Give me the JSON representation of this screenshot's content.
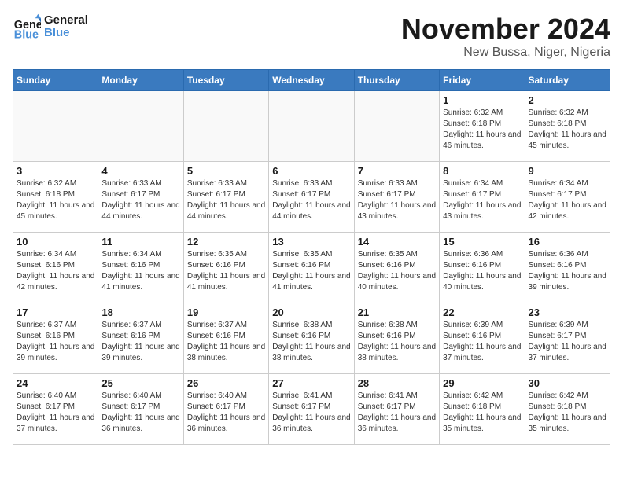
{
  "logo": {
    "general": "General",
    "blue": "Blue"
  },
  "title": "November 2024",
  "subtitle": "New Bussa, Niger, Nigeria",
  "header_days": [
    "Sunday",
    "Monday",
    "Tuesday",
    "Wednesday",
    "Thursday",
    "Friday",
    "Saturday"
  ],
  "weeks": [
    [
      {
        "day": "",
        "info": ""
      },
      {
        "day": "",
        "info": ""
      },
      {
        "day": "",
        "info": ""
      },
      {
        "day": "",
        "info": ""
      },
      {
        "day": "",
        "info": ""
      },
      {
        "day": "1",
        "info": "Sunrise: 6:32 AM\nSunset: 6:18 PM\nDaylight: 11 hours and 46 minutes."
      },
      {
        "day": "2",
        "info": "Sunrise: 6:32 AM\nSunset: 6:18 PM\nDaylight: 11 hours and 45 minutes."
      }
    ],
    [
      {
        "day": "3",
        "info": "Sunrise: 6:32 AM\nSunset: 6:18 PM\nDaylight: 11 hours and 45 minutes."
      },
      {
        "day": "4",
        "info": "Sunrise: 6:33 AM\nSunset: 6:17 PM\nDaylight: 11 hours and 44 minutes."
      },
      {
        "day": "5",
        "info": "Sunrise: 6:33 AM\nSunset: 6:17 PM\nDaylight: 11 hours and 44 minutes."
      },
      {
        "day": "6",
        "info": "Sunrise: 6:33 AM\nSunset: 6:17 PM\nDaylight: 11 hours and 44 minutes."
      },
      {
        "day": "7",
        "info": "Sunrise: 6:33 AM\nSunset: 6:17 PM\nDaylight: 11 hours and 43 minutes."
      },
      {
        "day": "8",
        "info": "Sunrise: 6:34 AM\nSunset: 6:17 PM\nDaylight: 11 hours and 43 minutes."
      },
      {
        "day": "9",
        "info": "Sunrise: 6:34 AM\nSunset: 6:17 PM\nDaylight: 11 hours and 42 minutes."
      }
    ],
    [
      {
        "day": "10",
        "info": "Sunrise: 6:34 AM\nSunset: 6:16 PM\nDaylight: 11 hours and 42 minutes."
      },
      {
        "day": "11",
        "info": "Sunrise: 6:34 AM\nSunset: 6:16 PM\nDaylight: 11 hours and 41 minutes."
      },
      {
        "day": "12",
        "info": "Sunrise: 6:35 AM\nSunset: 6:16 PM\nDaylight: 11 hours and 41 minutes."
      },
      {
        "day": "13",
        "info": "Sunrise: 6:35 AM\nSunset: 6:16 PM\nDaylight: 11 hours and 41 minutes."
      },
      {
        "day": "14",
        "info": "Sunrise: 6:35 AM\nSunset: 6:16 PM\nDaylight: 11 hours and 40 minutes."
      },
      {
        "day": "15",
        "info": "Sunrise: 6:36 AM\nSunset: 6:16 PM\nDaylight: 11 hours and 40 minutes."
      },
      {
        "day": "16",
        "info": "Sunrise: 6:36 AM\nSunset: 6:16 PM\nDaylight: 11 hours and 39 minutes."
      }
    ],
    [
      {
        "day": "17",
        "info": "Sunrise: 6:37 AM\nSunset: 6:16 PM\nDaylight: 11 hours and 39 minutes."
      },
      {
        "day": "18",
        "info": "Sunrise: 6:37 AM\nSunset: 6:16 PM\nDaylight: 11 hours and 39 minutes."
      },
      {
        "day": "19",
        "info": "Sunrise: 6:37 AM\nSunset: 6:16 PM\nDaylight: 11 hours and 38 minutes."
      },
      {
        "day": "20",
        "info": "Sunrise: 6:38 AM\nSunset: 6:16 PM\nDaylight: 11 hours and 38 minutes."
      },
      {
        "day": "21",
        "info": "Sunrise: 6:38 AM\nSunset: 6:16 PM\nDaylight: 11 hours and 38 minutes."
      },
      {
        "day": "22",
        "info": "Sunrise: 6:39 AM\nSunset: 6:16 PM\nDaylight: 11 hours and 37 minutes."
      },
      {
        "day": "23",
        "info": "Sunrise: 6:39 AM\nSunset: 6:17 PM\nDaylight: 11 hours and 37 minutes."
      }
    ],
    [
      {
        "day": "24",
        "info": "Sunrise: 6:40 AM\nSunset: 6:17 PM\nDaylight: 11 hours and 37 minutes."
      },
      {
        "day": "25",
        "info": "Sunrise: 6:40 AM\nSunset: 6:17 PM\nDaylight: 11 hours and 36 minutes."
      },
      {
        "day": "26",
        "info": "Sunrise: 6:40 AM\nSunset: 6:17 PM\nDaylight: 11 hours and 36 minutes."
      },
      {
        "day": "27",
        "info": "Sunrise: 6:41 AM\nSunset: 6:17 PM\nDaylight: 11 hours and 36 minutes."
      },
      {
        "day": "28",
        "info": "Sunrise: 6:41 AM\nSunset: 6:17 PM\nDaylight: 11 hours and 36 minutes."
      },
      {
        "day": "29",
        "info": "Sunrise: 6:42 AM\nSunset: 6:18 PM\nDaylight: 11 hours and 35 minutes."
      },
      {
        "day": "30",
        "info": "Sunrise: 6:42 AM\nSunset: 6:18 PM\nDaylight: 11 hours and 35 minutes."
      }
    ]
  ]
}
